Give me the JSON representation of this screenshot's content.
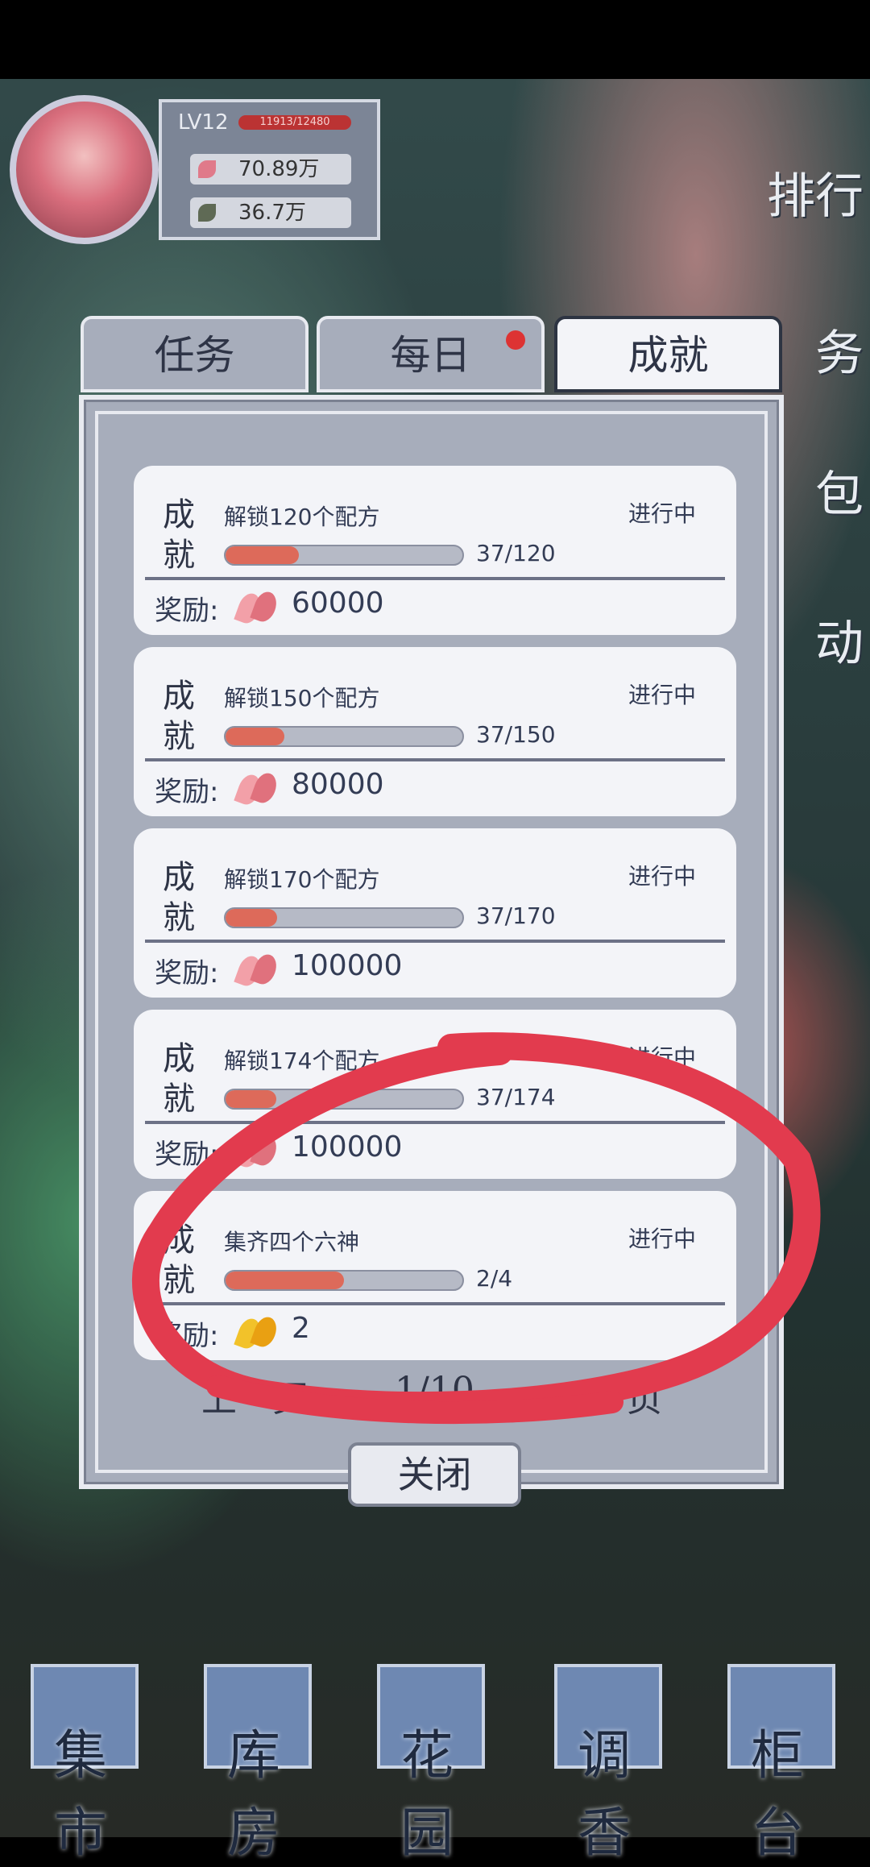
{
  "profile": {
    "level": "LV12",
    "xp": "11913/12480",
    "currency_petals": "70.89万",
    "currency_leaves": "36.7万"
  },
  "side_buttons": [
    "排行",
    "务",
    "包",
    "动"
  ],
  "tabs": [
    {
      "label": "任务"
    },
    {
      "label": "每日"
    },
    {
      "label": "成就"
    }
  ],
  "cards": [
    {
      "kind": "成就",
      "title": "解锁120个配方",
      "status": "进行中",
      "progress": "37/120",
      "progress_fraction": 0.308,
      "reward_label": "奖励:",
      "reward": "60000",
      "reward_icon": "pink-petal-icon"
    },
    {
      "kind": "成就",
      "title": "解锁150个配方",
      "status": "进行中",
      "progress": "37/150",
      "progress_fraction": 0.247,
      "reward_label": "奖励:",
      "reward": "80000",
      "reward_icon": "pink-petal-icon"
    },
    {
      "kind": "成就",
      "title": "解锁170个配方",
      "status": "进行中",
      "progress": "37/170",
      "progress_fraction": 0.218,
      "reward_label": "奖励:",
      "reward": "100000",
      "reward_icon": "pink-petal-icon"
    },
    {
      "kind": "成就",
      "title": "解锁174个配方",
      "status": "进行中",
      "progress": "37/174",
      "progress_fraction": 0.213,
      "reward_label": "奖励:",
      "reward": "100000",
      "reward_icon": "pink-petal-icon"
    },
    {
      "kind": "成就",
      "title": "集齐四个六神",
      "status": "进行中",
      "progress": "2/4",
      "progress_fraction": 0.5,
      "reward_label": "奖励:",
      "reward": "2",
      "reward_icon": "gold-petal-icon"
    }
  ],
  "pager": {
    "prev": "上一页",
    "page": "1/10",
    "next": "下一页"
  },
  "close": "关闭",
  "bottom_nav": [
    "集市",
    "库房",
    "花园",
    "调香",
    "柜台"
  ],
  "colors": {
    "annotation": "#e23b4e",
    "progress_fill": "#dd6a5a"
  }
}
